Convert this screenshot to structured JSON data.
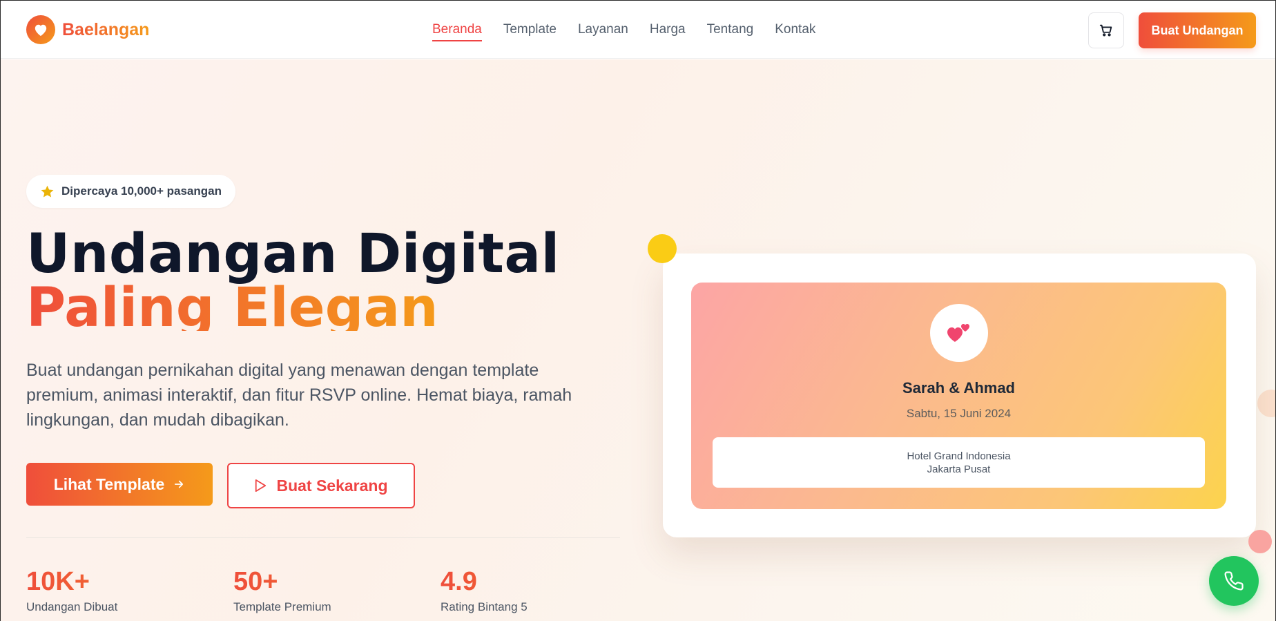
{
  "header": {
    "brand_name": "Baelangan",
    "nav": [
      {
        "label": "Beranda",
        "active": true
      },
      {
        "label": "Template"
      },
      {
        "label": "Layanan"
      },
      {
        "label": "Harga"
      },
      {
        "label": "Tentang"
      },
      {
        "label": "Kontak"
      }
    ],
    "cart_icon": "cart-icon",
    "cta_label": "Buat Undangan"
  },
  "hero": {
    "trust_badge": "Dipercaya 10,000+ pasangan",
    "headline_line1": "Undangan Digital",
    "headline_line2": "Paling Elegan",
    "description": "Buat undangan pernikahan digital yang menawan dengan template premium, animasi interaktif, dan fitur RSVP online. Hemat biaya, ramah lingkungan, dan mudah dibagikan.",
    "primary_button": "Lihat Template",
    "secondary_button": "Buat Sekarang",
    "stats": [
      {
        "value": "10K+",
        "label": "Undangan Dibuat"
      },
      {
        "value": "50+",
        "label": "Template Premium"
      },
      {
        "value": "4.9",
        "label": "Rating Bintang 5"
      }
    ]
  },
  "preview_card": {
    "couple": "Sarah & Ahmad",
    "date": "Sabtu, 15 Juni 2024",
    "venue_line1": "Hotel Grand Indonesia",
    "venue_line2": "Jakarta Pusat"
  },
  "colors": {
    "accent_red": "#ef4444",
    "gradient_start": "#ef4e3b",
    "gradient_end": "#f59a1a",
    "whatsapp_green": "#22c55e",
    "star_yellow": "#eab308"
  }
}
